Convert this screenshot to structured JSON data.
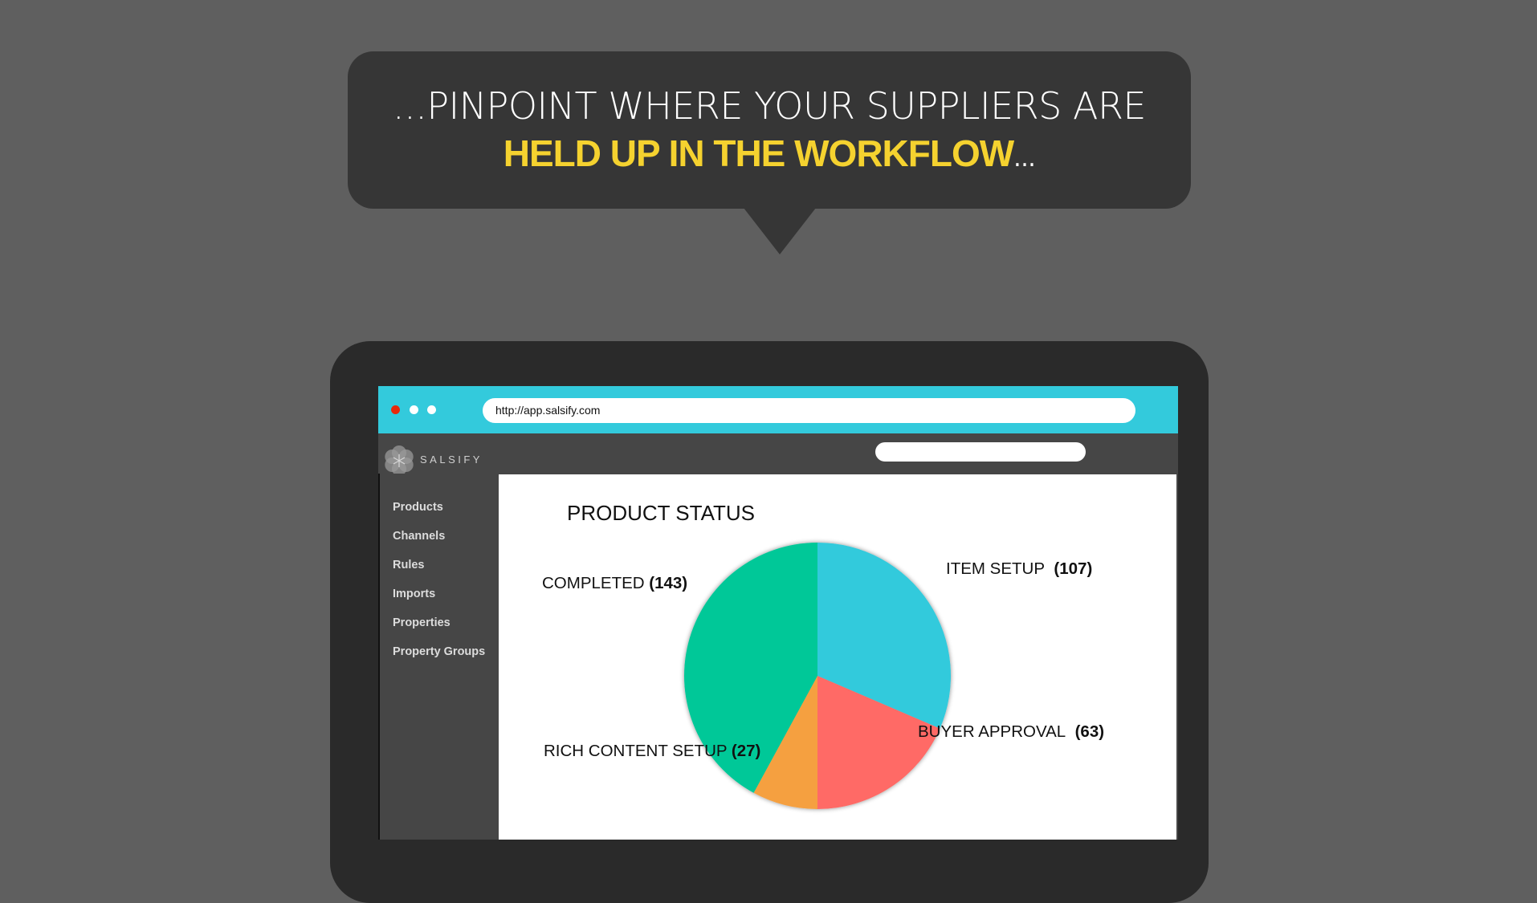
{
  "banner": {
    "line1": "...PINPOINT WHERE YOUR SUPPLIERS ARE",
    "line2_highlight": "HELD UP IN THE WORKFLOW",
    "line2_suffix": "...",
    "highlight_color": "#f5d22f"
  },
  "browser": {
    "url": "http://app.salsify.com",
    "accent_color": "#33cadc",
    "window_dots": [
      "close",
      "minimize",
      "maximize"
    ]
  },
  "app": {
    "logo_icon": "salsify-flower-logo",
    "logo_text": "SALSIFY",
    "search": {
      "value": "",
      "placeholder": ""
    },
    "sidebar": {
      "items": [
        {
          "label": "Products"
        },
        {
          "label": "Channels"
        },
        {
          "label": "Rules"
        },
        {
          "label": "Imports"
        },
        {
          "label": "Properties"
        },
        {
          "label": "Property Groups"
        }
      ]
    }
  },
  "chart_data": {
    "type": "pie",
    "title": "PRODUCT STATUS",
    "categories": [
      "ITEM SETUP",
      "BUYER APPROVAL",
      "RICH CONTENT SETUP",
      "COMPLETED"
    ],
    "values": [
      107,
      63,
      27,
      143
    ],
    "colors": [
      "#33cadc",
      "#ff6b66",
      "#f5a041",
      "#00c898"
    ],
    "labels": [
      {
        "name": "ITEM SETUP",
        "value_text": "(107)"
      },
      {
        "name": "BUYER APPROVAL",
        "value_text": "(63)"
      },
      {
        "name": "RICH CONTENT SETUP",
        "value_text": "(27)"
      },
      {
        "name": "COMPLETED",
        "value_text": "(143)"
      }
    ],
    "legend": "none"
  }
}
